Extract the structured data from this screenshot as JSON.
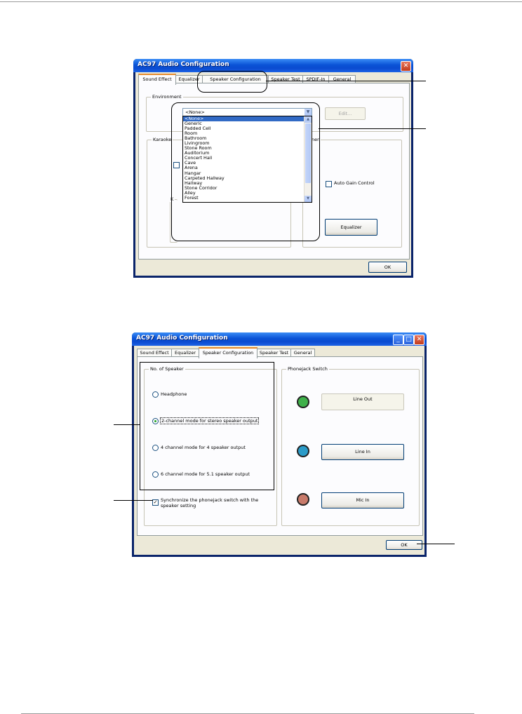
{
  "dialog1": {
    "title": "AC97 Audio Configuration",
    "close_glyph": "✕",
    "tabs": [
      "Sound Effect",
      "Equalizer",
      "Speaker Configuration",
      "Speaker Test",
      "SPDIF-In",
      "General"
    ],
    "active_tab": "Sound Effect",
    "environment_label": "Environment",
    "environment_value": "<None>",
    "edit_button": "Edit...",
    "karaoke_label": "Karaoke",
    "k_label": "K",
    "other_group_label": "ner",
    "auto_gain_control": "Auto Gain Control",
    "equalizer_button": "Equalizer",
    "ok_button": "OK",
    "environment_options": [
      "<None>",
      "Generic",
      "Padded Cell",
      "Room",
      "Bathroom",
      "Livingroom",
      "Stone Room",
      "Auditorium",
      "Concert Hall",
      "Cave",
      "Arena",
      "Hangar",
      "Carpeted Hallway",
      "Hallway",
      "Stone Corridor",
      "Alley",
      "Forest"
    ],
    "selected_option": "<None>"
  },
  "dialog2": {
    "title": "AC97 Audio Configuration",
    "tabs": [
      "Sound Effect",
      "Equalizer",
      "Speaker Configuration",
      "Speaker Test",
      "General"
    ],
    "active_tab": "Speaker Configuration",
    "no_of_speaker_label": "No. of Speaker",
    "speaker_options": [
      "Headphone",
      "2-channel mode for stereo speaker output",
      "4 channel mode for 4 speaker output",
      "6 channel mode for 5.1 speaker output"
    ],
    "selected_speaker_option": "2-channel mode for stereo speaker output",
    "sync_label_line1": "Synchronize the phonejack switch with the",
    "sync_label_line2": "speaker setting",
    "sync_checked": true,
    "phonejack_label": "Phonejack Switch",
    "jack_buttons": [
      "Line Out",
      "Line In",
      "Mic In"
    ],
    "jack_colors": [
      "#3fb04a",
      "#2b9bc8",
      "#c87a6a"
    ],
    "ok_button": "OK",
    "minimize_glyph": "_",
    "maximize_glyph": "□",
    "close_glyph": "✕"
  },
  "colors": {
    "titlebar": "#0a53d6",
    "dialog_bg": "#ece9d8",
    "selection": "#316ac5",
    "tab_accent": "#e68b2c"
  }
}
